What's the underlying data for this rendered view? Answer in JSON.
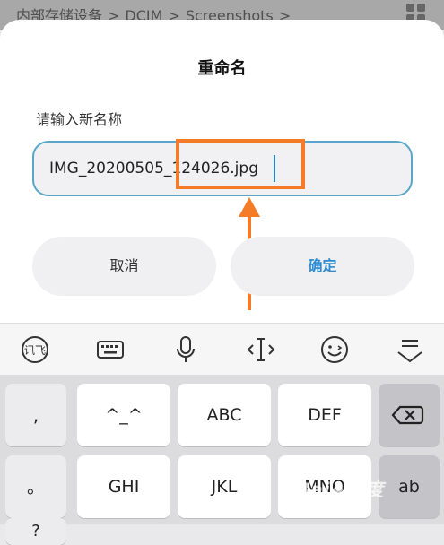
{
  "background": {
    "breadcrumb": [
      "内部存储设备",
      ">",
      "DCIM",
      ">",
      "Screenshots",
      ">"
    ]
  },
  "dialog": {
    "title": "重命名",
    "label": "请输入新名称",
    "input_value": "IMG_20200505_124026.jpg",
    "cancel": "取消",
    "confirm": "确定"
  },
  "toolbar": {
    "icons": [
      "voice-input-logo-icon",
      "keyboard-icon",
      "microphone-icon",
      "cursor-move-icon",
      "emoji-icon",
      "collapse-keyboard-icon"
    ]
  },
  "keyboard": {
    "side_keys": [
      ",",
      "。",
      "?"
    ],
    "row1": [
      "^_^",
      "ABC",
      "DEF"
    ],
    "row2": [
      "GHI",
      "JKL",
      "MNO"
    ],
    "right_key": "ab"
  },
  "colors": {
    "accent": "#2e8bd0",
    "highlight": "#f47c28",
    "input_border": "#5aa6c8"
  },
  "watermark": "Baidu"
}
